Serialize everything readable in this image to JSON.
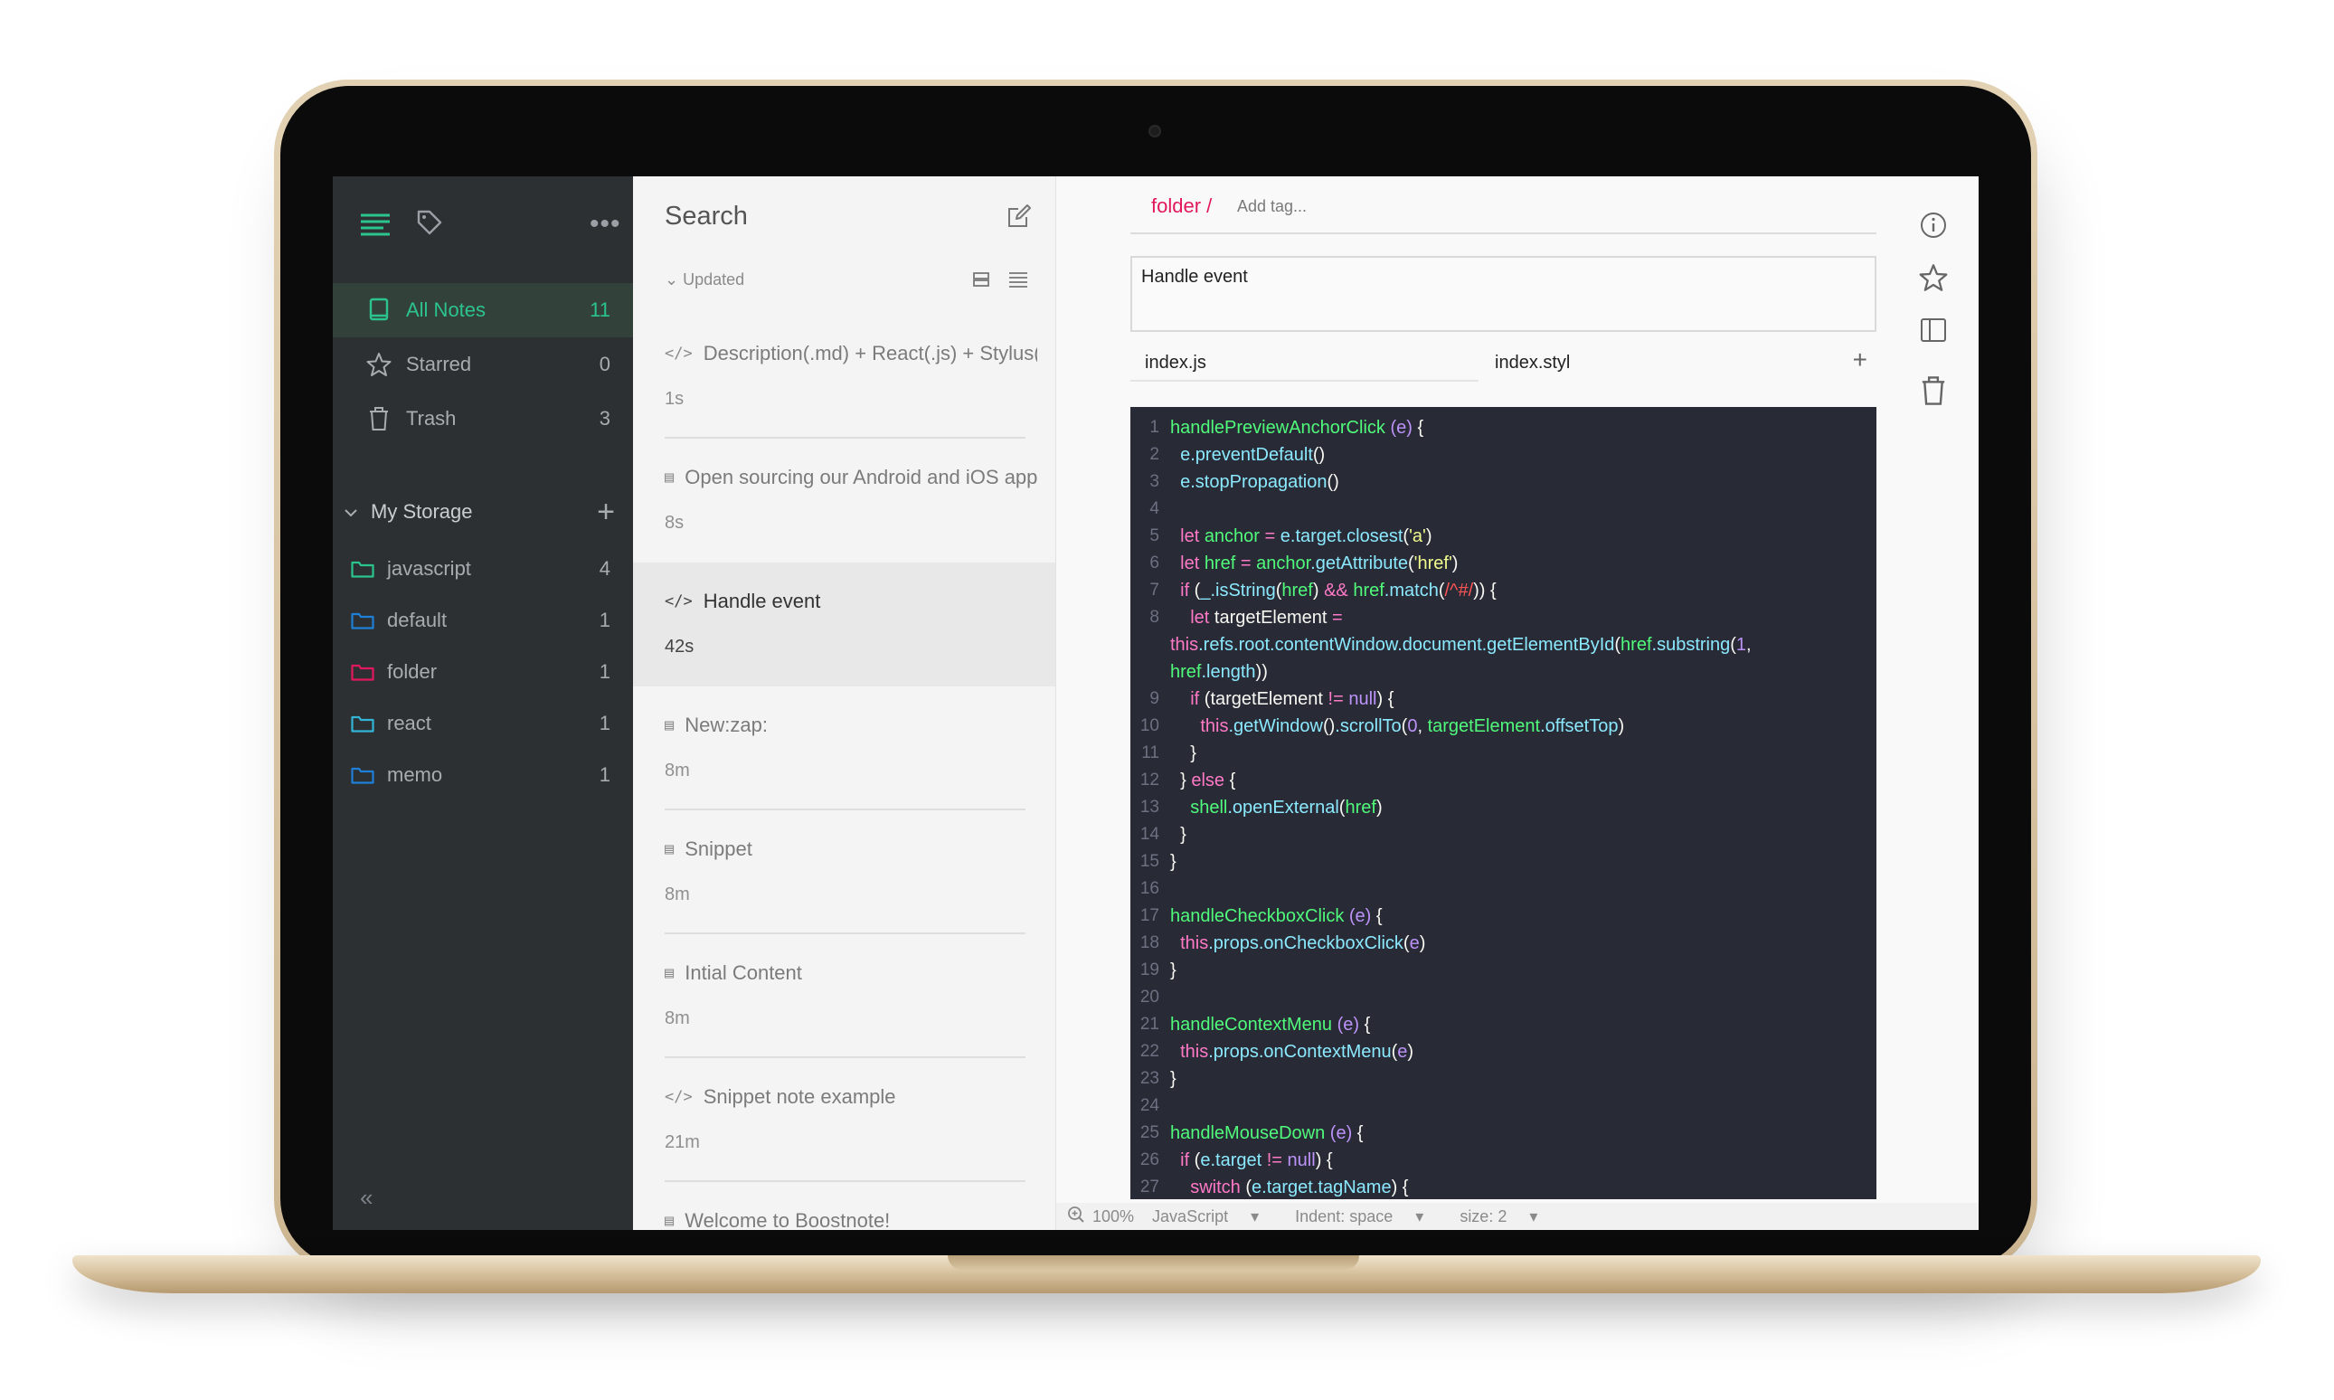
{
  "sidebar": {
    "nav": [
      {
        "label": "All Notes",
        "count": "11",
        "icon": "notebook-icon"
      },
      {
        "label": "Starred",
        "count": "0",
        "icon": "star-icon"
      },
      {
        "label": "Trash",
        "count": "3",
        "icon": "trash-icon"
      }
    ],
    "storage_title": "My Storage",
    "folders": [
      {
        "label": "javascript",
        "count": "4",
        "color": "#2bc48d"
      },
      {
        "label": "default",
        "count": "1",
        "color": "#1e7fd6"
      },
      {
        "label": "folder",
        "count": "1",
        "color": "#e2185c"
      },
      {
        "label": "react",
        "count": "1",
        "color": "#32b4d6"
      },
      {
        "label": "memo",
        "count": "1",
        "color": "#1e7fd6"
      }
    ],
    "collapse_glyph": "«"
  },
  "notelist": {
    "search_label": "Search",
    "sort_label": "Updated",
    "notes": [
      {
        "title": "Description(.md) + React(.js) + Stylus(.styl)",
        "time": "1s",
        "type": "snippet"
      },
      {
        "title": "Open sourcing our Android and iOS apps",
        "time": "8s",
        "type": "markdown"
      },
      {
        "title": "Handle event",
        "time": "42s",
        "type": "snippet"
      },
      {
        "title": "New:zap:",
        "time": "8m",
        "type": "markdown"
      },
      {
        "title": "Snippet",
        "time": "8m",
        "type": "markdown"
      },
      {
        "title": "Intial Content",
        "time": "8m",
        "type": "markdown"
      },
      {
        "title": "Snippet note example",
        "time": "21m",
        "type": "snippet"
      },
      {
        "title": "Welcome to Boostnote!",
        "time": "",
        "type": "markdown"
      }
    ]
  },
  "editor": {
    "folder": "folder /",
    "tag_placeholder": "Add tag...",
    "description": "Handle event",
    "tabs": [
      "index.js",
      "index.styl"
    ],
    "add_tab": "+",
    "status": {
      "zoom": "100%",
      "mode": "JavaScript",
      "indent": "Indent: space",
      "size": "size: 2"
    }
  },
  "colors": {
    "accent": "#2bc48d",
    "folder_red": "#e2185c",
    "sidebar_bg": "#2c3033",
    "code_bg": "#282a36"
  }
}
